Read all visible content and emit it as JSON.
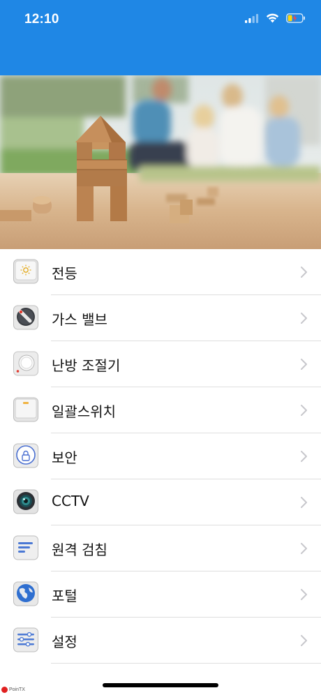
{
  "status": {
    "time": "12:10",
    "icons": [
      "cellular-signal-icon",
      "wifi-icon",
      "battery-charging-icon"
    ]
  },
  "colors": {
    "header_blue": "#1f87e5",
    "divider": "#dedede",
    "chevron": "#c7c7cc"
  },
  "hero": {
    "description": "banner-photo"
  },
  "menu": [
    {
      "label": "전등",
      "icon": "light-switch-icon"
    },
    {
      "label": "가스 밸브",
      "icon": "gas-valve-icon"
    },
    {
      "label": "난방 조절기",
      "icon": "thermostat-icon"
    },
    {
      "label": "일괄스위치",
      "icon": "master-switch-icon"
    },
    {
      "label": "보안",
      "icon": "security-lock-icon"
    },
    {
      "label": "CCTV",
      "icon": "camera-icon"
    },
    {
      "label": "원격 검침",
      "icon": "meter-reading-icon"
    },
    {
      "label": "포털",
      "icon": "globe-icon"
    },
    {
      "label": "설정",
      "icon": "settings-sliders-icon"
    }
  ],
  "watermark": "PoinTX"
}
